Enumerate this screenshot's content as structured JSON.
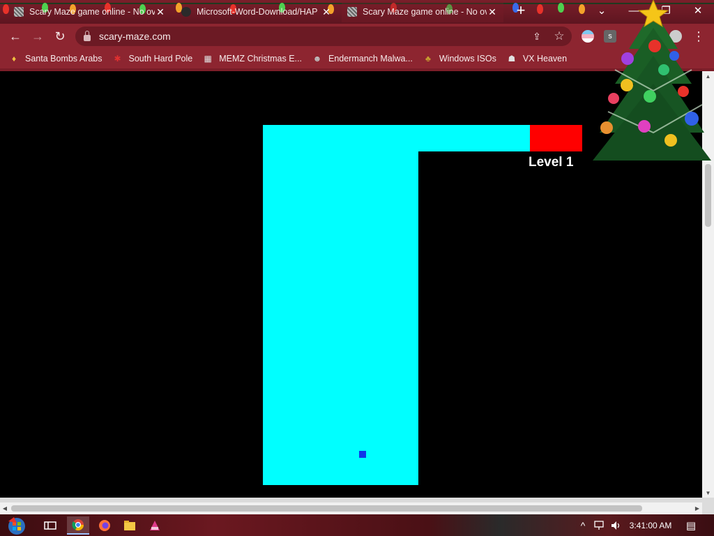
{
  "tabs": [
    {
      "title": "Scary Maze game online - No ov",
      "close": "✕",
      "active": false
    },
    {
      "title": "Microsoft-Word-Download/HAP",
      "close": "✕",
      "active": false
    },
    {
      "title": "Scary Maze game online - No ov",
      "close": "✕",
      "active": true
    }
  ],
  "window_controls": {
    "new_tab": "+",
    "tab_search": "⌄",
    "minimize": "—",
    "restore": "❐",
    "close": "✕"
  },
  "toolbar": {
    "back": "←",
    "forward": "→",
    "reload": "↻",
    "url": "scary-maze.com",
    "share_icon": "⇪",
    "star_icon": "☆",
    "menu_icon": "⋮",
    "extension_letter": "s"
  },
  "bookmarks": [
    {
      "label": "Santa Bombs Arabs",
      "icon": "♦",
      "icon_color": "#f0c040"
    },
    {
      "label": "South Hard Pole",
      "icon": "✱",
      "icon_color": "#e03030"
    },
    {
      "label": "MEMZ Christmas E...",
      "icon": "▦",
      "icon_color": "#e0e0e0"
    },
    {
      "label": "Endermanch Malwa...",
      "icon": "☻",
      "icon_color": "#c0c0c0"
    },
    {
      "label": "Windows ISOs",
      "icon": "♣",
      "icon_color": "#c8a030"
    },
    {
      "label": "VX Heaven",
      "icon": "☗",
      "icon_color": "#e0e0e0"
    }
  ],
  "game": {
    "level_label": "Level 1",
    "path_color": "#00ffff",
    "goal_color": "#ff0000",
    "player_color": "#1036e8",
    "background_color": "#000000"
  },
  "taskbar": {
    "clock": "3:41:00 AM",
    "tray_arrow": "^",
    "notification_icon": "▤"
  },
  "theme": {
    "accent": "#8d2530",
    "tab_strip": "#6e1a25"
  }
}
